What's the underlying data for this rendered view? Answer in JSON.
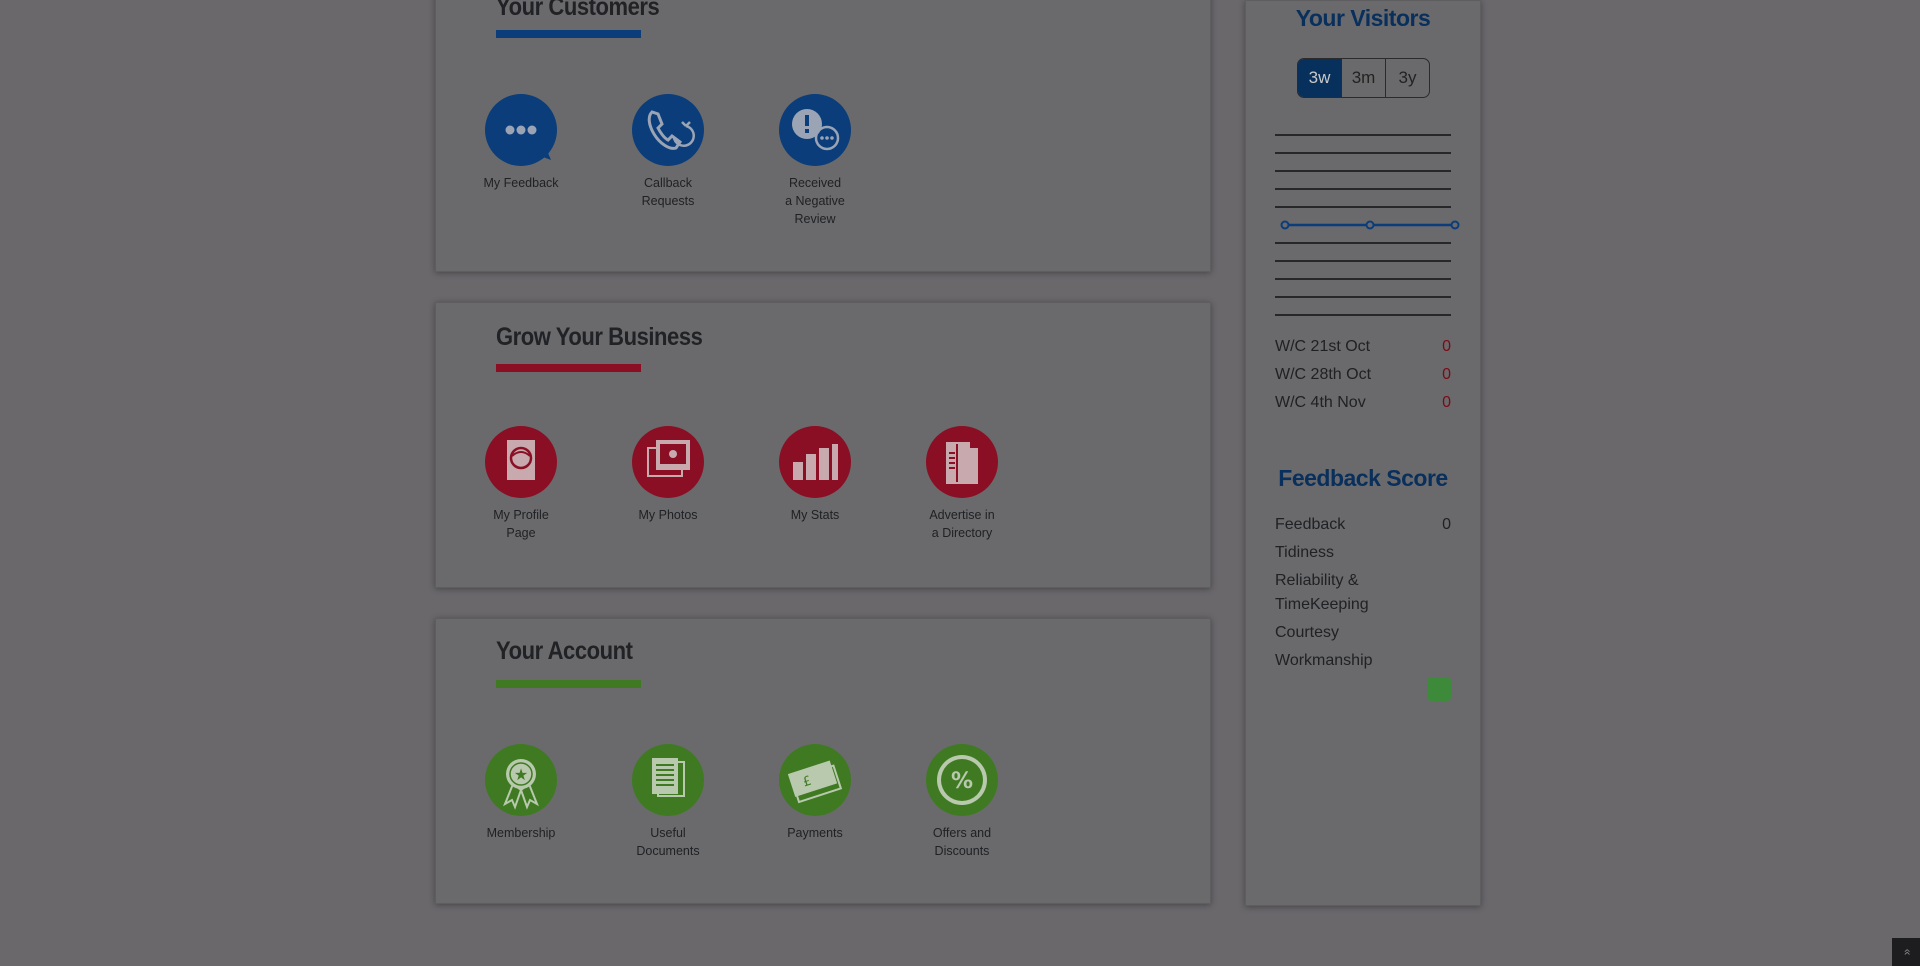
{
  "customers": {
    "title": "Your Customers",
    "accent": "#0a3d7a",
    "items": [
      {
        "label": "My Feedback",
        "icon": "speech-bubble-icon"
      },
      {
        "label": "Callback Requests",
        "icon": "phone-callback-icon"
      },
      {
        "label": "Received a Negative Review",
        "icon": "alert-chat-icon"
      }
    ]
  },
  "grow": {
    "title": "Grow Your Business",
    "accent": "#8a0f24",
    "items": [
      {
        "label": "My Profile Page",
        "icon": "profile-page-icon"
      },
      {
        "label": "My Photos",
        "icon": "photos-icon"
      },
      {
        "label": "My Stats",
        "icon": "bar-chart-icon"
      },
      {
        "label": "Advertise in a Directory",
        "icon": "directory-icon"
      }
    ]
  },
  "account": {
    "title": "Your Account",
    "accent": "#3f7a22",
    "items": [
      {
        "label": "Membership",
        "icon": "award-ribbon-icon"
      },
      {
        "label": "Useful Documents",
        "icon": "documents-icon"
      },
      {
        "label": "Payments",
        "icon": "pound-banknote-icon"
      },
      {
        "label": "Offers and Discounts",
        "icon": "percent-badge-icon"
      }
    ]
  },
  "visitors": {
    "title": "Your Visitors",
    "ranges": [
      "3w",
      "3m",
      "3y"
    ],
    "selected_range": "3w",
    "rows": [
      {
        "label": "W/C 21st Oct",
        "value": "0"
      },
      {
        "label": "W/C 28th Oct",
        "value": "0"
      },
      {
        "label": "W/C 4th Nov",
        "value": "0"
      }
    ]
  },
  "chart_data": {
    "type": "line",
    "categories": [
      "W/C 21st Oct",
      "W/C 28th Oct",
      "W/C 4th Nov"
    ],
    "values": [
      0,
      0,
      0
    ],
    "grid": true,
    "color": "#0a3d7a"
  },
  "feedback_score": {
    "title": "Feedback Score",
    "rows": [
      {
        "label": "Feedback",
        "value": "0"
      },
      {
        "label": "Tidiness",
        "value": ""
      },
      {
        "label": "Reliability & TimeKeeping",
        "value": ""
      },
      {
        "label": "Courtesy",
        "value": ""
      },
      {
        "label": "Workmanship",
        "value": ""
      }
    ],
    "indicator_color": "#3d8a3a"
  },
  "scroll_top": {
    "icon": "double-chevron-up-icon",
    "glyph": "»"
  }
}
